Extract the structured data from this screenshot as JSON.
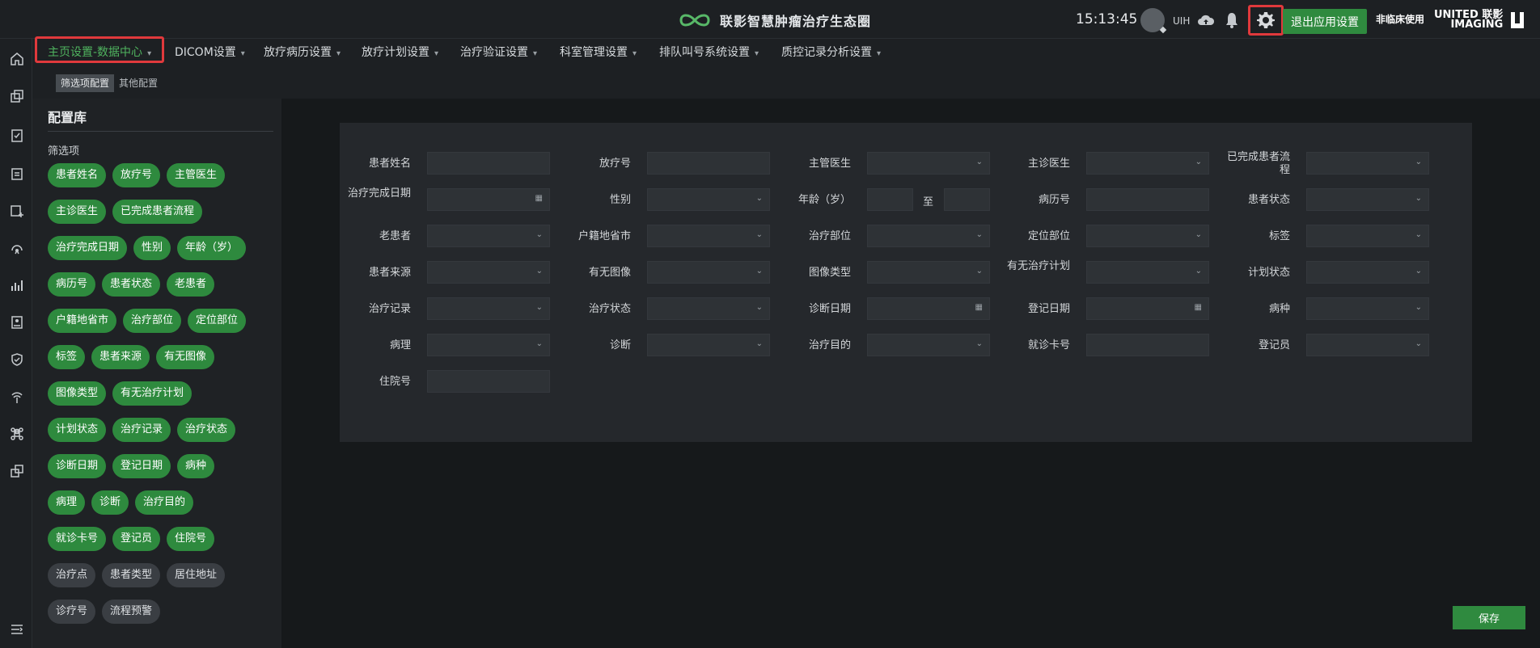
{
  "header": {
    "brand_title": "联影智慧肿瘤治疗生态圈",
    "clock": "15:13:45",
    "user": "UIH",
    "exit_label": "退出应用设置",
    "nonclinical": "非临床使用",
    "vendor_line1": "UNITED 联影",
    "vendor_line2": "IMAGING",
    "accent_color": "#2f8a3f",
    "highlight_color": "#e0393c"
  },
  "menu": [
    {
      "label": "主页设置-数据中心",
      "active": true
    },
    {
      "label": "DICOM设置"
    },
    {
      "label": "放疗病历设置"
    },
    {
      "label": "放疗计划设置"
    },
    {
      "label": "治疗验证设置"
    },
    {
      "label": "科室管理设置"
    },
    {
      "label": "排队叫号系统设置"
    },
    {
      "label": "质控记录分析设置"
    }
  ],
  "subtabs": [
    {
      "label": "筛选项配置",
      "active": true
    },
    {
      "label": "其他配置"
    }
  ],
  "library": {
    "title": "配置库",
    "subtitle": "筛选项",
    "chips_active": [
      "患者姓名",
      "放疗号",
      "主管医生",
      "主诊医生",
      "已完成患者流程",
      "治疗完成日期",
      "性别",
      "年龄（岁）",
      "病历号",
      "患者状态",
      "老患者",
      "户籍地省市",
      "治疗部位",
      "定位部位",
      "标签",
      "患者来源",
      "有无图像",
      "图像类型",
      "有无治疗计划",
      "计划状态",
      "治疗记录",
      "治疗状态",
      "诊断日期",
      "登记日期",
      "病种",
      "病理",
      "诊断",
      "治疗目的",
      "就诊卡号",
      "登记员",
      "住院号"
    ],
    "chips_inactive": [
      "治疗点",
      "患者类型",
      "居住地址",
      "诊疗号",
      "流程预警"
    ]
  },
  "form": {
    "fields": [
      {
        "label": "患者姓名",
        "kind": "text"
      },
      {
        "label": "放疗号",
        "kind": "text"
      },
      {
        "label": "主管医生",
        "kind": "select"
      },
      {
        "label": "主诊医生",
        "kind": "select"
      },
      {
        "label": "已完成患者流程",
        "kind": "select"
      },
      {
        "label": "治疗完成日期",
        "kind": "date"
      },
      {
        "label": "性别",
        "kind": "select"
      },
      {
        "label": "年龄（岁）",
        "kind": "range"
      },
      {
        "label": "病历号",
        "kind": "text"
      },
      {
        "label": "患者状态",
        "kind": "select"
      },
      {
        "label": "老患者",
        "kind": "select"
      },
      {
        "label": "户籍地省市",
        "kind": "select"
      },
      {
        "label": "治疗部位",
        "kind": "select"
      },
      {
        "label": "定位部位",
        "kind": "select"
      },
      {
        "label": "标签",
        "kind": "select"
      },
      {
        "label": "患者来源",
        "kind": "select"
      },
      {
        "label": "有无图像",
        "kind": "select"
      },
      {
        "label": "图像类型",
        "kind": "select"
      },
      {
        "label": "有无治疗计划",
        "kind": "select"
      },
      {
        "label": "计划状态",
        "kind": "select"
      },
      {
        "label": "治疗记录",
        "kind": "select"
      },
      {
        "label": "治疗状态",
        "kind": "select"
      },
      {
        "label": "诊断日期",
        "kind": "date"
      },
      {
        "label": "登记日期",
        "kind": "date"
      },
      {
        "label": "病种",
        "kind": "select"
      },
      {
        "label": "病理",
        "kind": "select"
      },
      {
        "label": "诊断",
        "kind": "select"
      },
      {
        "label": "治疗目的",
        "kind": "select"
      },
      {
        "label": "就诊卡号",
        "kind": "text"
      },
      {
        "label": "登记员",
        "kind": "select"
      },
      {
        "label": "住院号",
        "kind": "text"
      }
    ],
    "range_separator": "至"
  },
  "save_label": "保存",
  "rail_icons": [
    "home-icon",
    "windows-icon",
    "clipboard-check-icon",
    "calendar-list-icon",
    "image-plus-icon",
    "radiation-icon",
    "bar-chart-icon",
    "id-card-icon",
    "shield-check-icon",
    "antenna-icon",
    "command-icon",
    "window-stack-icon",
    "collapse-menu-icon"
  ]
}
